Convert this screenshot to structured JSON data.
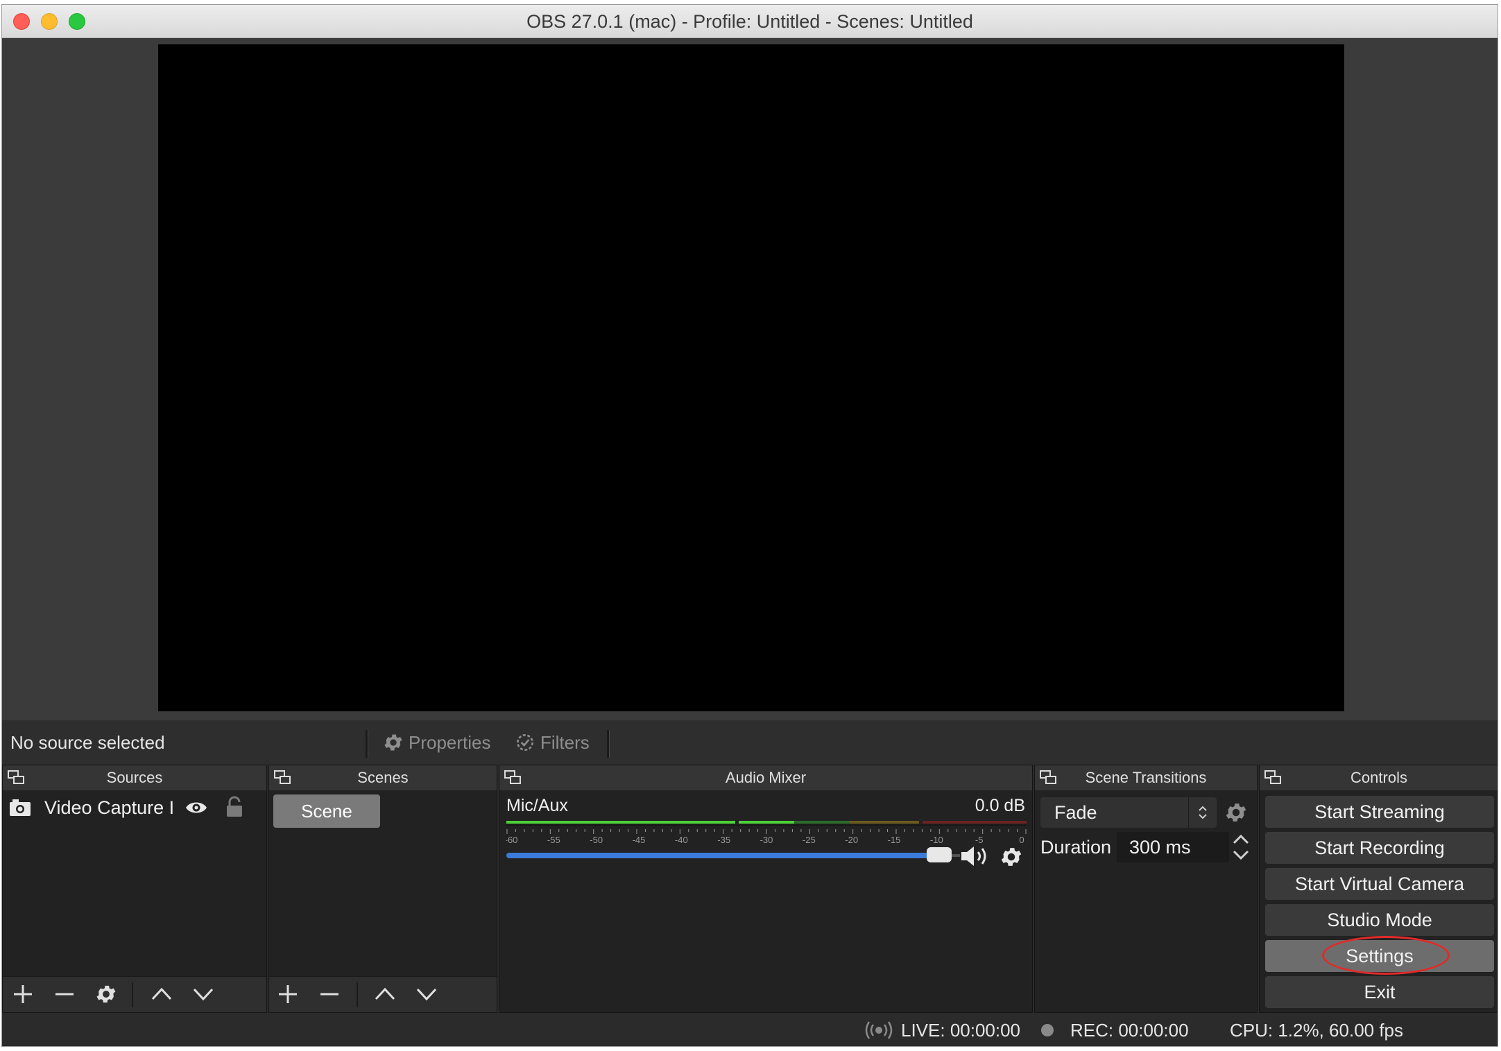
{
  "window": {
    "title": "OBS 27.0.1 (mac) - Profile: Untitled - Scenes: Untitled"
  },
  "source_toolbar": {
    "status": "No source selected",
    "properties_label": "Properties",
    "filters_label": "Filters"
  },
  "docks": {
    "sources": {
      "title": "Sources",
      "items": [
        {
          "label": "Video Capture I",
          "visible": true,
          "locked": false
        }
      ]
    },
    "scenes": {
      "title": "Scenes",
      "items": [
        {
          "label": "Scene",
          "selected": true
        }
      ]
    },
    "audio_mixer": {
      "title": "Audio Mixer",
      "channels": [
        {
          "name": "Mic/Aux",
          "level": "0.0 dB",
          "volume": 0.93
        }
      ],
      "ticks": [
        "-60",
        "-55",
        "-50",
        "-45",
        "-40",
        "-35",
        "-30",
        "-25",
        "-20",
        "-15",
        "-10",
        "-5",
        "0"
      ]
    },
    "scene_transitions": {
      "title": "Scene Transitions",
      "transition": "Fade",
      "duration_label": "Duration",
      "duration_value": "300 ms"
    },
    "controls": {
      "title": "Controls",
      "buttons": [
        "Start Streaming",
        "Start Recording",
        "Start Virtual Camera",
        "Studio Mode",
        "Settings",
        "Exit"
      ],
      "highlighted": "Settings"
    }
  },
  "status_bar": {
    "live": "LIVE: 00:00:00",
    "rec": "REC: 00:00:00",
    "cpu": "CPU: 1.2%, 60.00 fps"
  },
  "colors": {
    "highlight": "#e02b2b",
    "meter_green": "#4cd137",
    "meter_yellow": "#c9a227",
    "meter_red": "#b83232",
    "volume_blue": "#3a7bdc"
  }
}
